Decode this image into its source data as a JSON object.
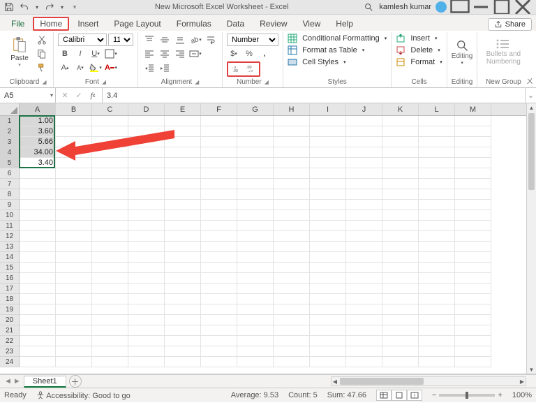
{
  "titlebar": {
    "doc_title": "New Microsoft Excel Worksheet - Excel",
    "account_name": "kamlesh kumar"
  },
  "tabs": {
    "file": "File",
    "home": "Home",
    "insert": "Insert",
    "page_layout": "Page Layout",
    "formulas": "Formulas",
    "data": "Data",
    "review": "Review",
    "view": "View",
    "help": "Help",
    "share": "Share"
  },
  "ribbon": {
    "clipboard": {
      "label": "Clipboard",
      "paste": "Paste"
    },
    "font": {
      "label": "Font",
      "font_name": "Calibri",
      "font_size": "11"
    },
    "alignment": {
      "label": "Alignment"
    },
    "number": {
      "label": "Number",
      "format_selected": "Number"
    },
    "styles": {
      "label": "Styles",
      "cond_fmt": "Conditional Formatting",
      "fmt_table": "Format as Table",
      "cell_styles": "Cell Styles"
    },
    "cells": {
      "label": "Cells",
      "insert": "Insert",
      "delete": "Delete",
      "format": "Format"
    },
    "editing": {
      "label": "Editing",
      "btn": "Editing"
    },
    "newgroup": {
      "label": "New Group",
      "btn": "Bullets and Numbering"
    }
  },
  "fx": {
    "name_box": "A5",
    "formula": "3.4"
  },
  "grid": {
    "columns": [
      "A",
      "B",
      "C",
      "D",
      "E",
      "F",
      "G",
      "H",
      "I",
      "J",
      "K",
      "L",
      "M"
    ],
    "rows": 24,
    "selected_col": "A",
    "selected_rows": [
      1,
      2,
      3,
      4,
      5
    ],
    "active_row": 5,
    "cells": {
      "A1": "1.00",
      "A2": "3.60",
      "A3": "5.66",
      "A4": "34.00",
      "A5": "3.40"
    }
  },
  "sheets": {
    "active": "Sheet1"
  },
  "status": {
    "ready": "Ready",
    "accessibility": "Accessibility: Good to go",
    "average_label": "Average:",
    "average_val": "9.53",
    "count_label": "Count:",
    "count_val": "5",
    "sum_label": "Sum:",
    "sum_val": "47.66",
    "zoom": "100%"
  }
}
